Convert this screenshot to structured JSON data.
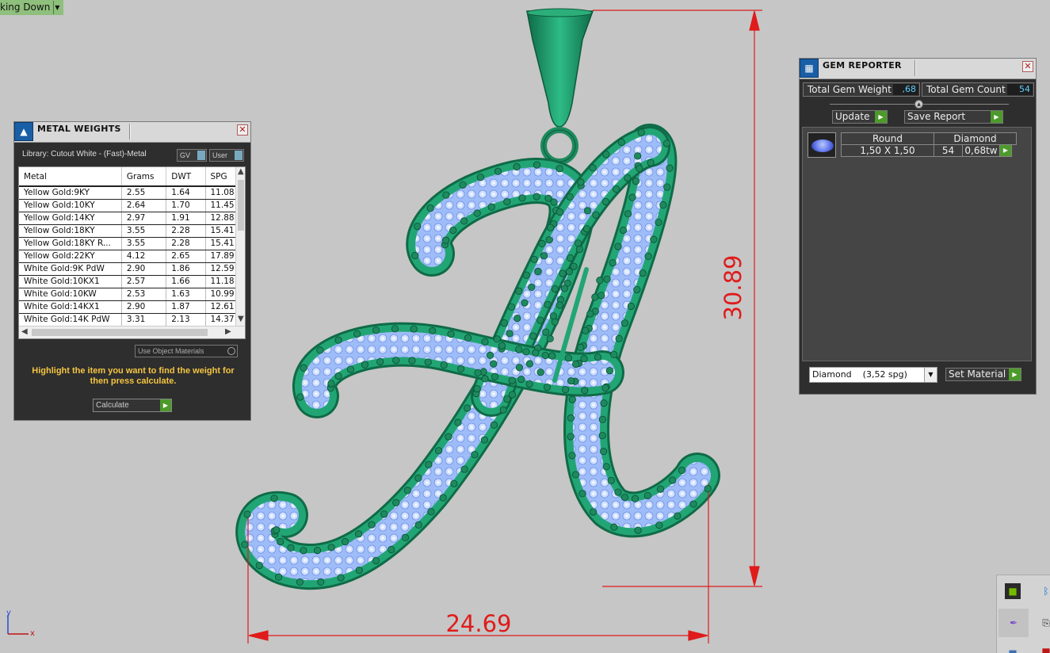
{
  "viewport": {
    "label": "king Down"
  },
  "dimensions": {
    "width": "24.69",
    "height": "30.89"
  },
  "axes": {
    "y": "y",
    "x": "x"
  },
  "metal_weights": {
    "title": "METAL WEIGHTS",
    "library": "Library: Cutout White - (Fast)-Metal",
    "btn_gv": "GV",
    "btn_user": "User",
    "columns": [
      "Metal",
      "Grams",
      "DWT",
      "SPG"
    ],
    "rows": [
      [
        "Yellow Gold:9KY",
        "2.55",
        "1.64",
        "11.08"
      ],
      [
        "Yellow Gold:10KY",
        "2.64",
        "1.70",
        "11.45"
      ],
      [
        "Yellow Gold:14KY",
        "2.97",
        "1.91",
        "12.88"
      ],
      [
        "Yellow Gold:18KY",
        "3.55",
        "2.28",
        "15.41"
      ],
      [
        "Yellow Gold:18KY R...",
        "3.55",
        "2.28",
        "15.41"
      ],
      [
        "Yellow Gold:22KY",
        "4.12",
        "2.65",
        "17.89"
      ],
      [
        "White Gold:9K PdW",
        "2.90",
        "1.86",
        "12.59"
      ],
      [
        "White Gold:10KX1",
        "2.57",
        "1.66",
        "11.18"
      ],
      [
        "White Gold:10KW",
        "2.53",
        "1.63",
        "10.99"
      ],
      [
        "White Gold:14KX1",
        "2.90",
        "1.87",
        "12.61"
      ],
      [
        "White Gold:14K PdW",
        "3.31",
        "2.13",
        "14.37"
      ]
    ],
    "use_object_materials": "Use Object Materials",
    "hint": "Highlight the item you want to find the weight for then press calculate.",
    "calculate": "Calculate"
  },
  "gem_reporter": {
    "title": "GEM REPORTER",
    "total_weight_label": "Total Gem Weight",
    "total_weight_value": ",68",
    "total_count_label": "Total Gem Count",
    "total_count_value": "54",
    "update": "Update",
    "save_report": "Save Report",
    "gem": {
      "shape": "Round",
      "material": "Diamond",
      "size": "1,50 X 1,50",
      "count": "54",
      "weight": "0,68tw"
    },
    "material_select": "Diamond    (3,52 spg)",
    "set_material": "Set Material"
  },
  "colors": {
    "metal_green": "#1f9e6e",
    "stone_blue": "#8fb4f4",
    "dimension_red": "#e01b1b",
    "viewport_bg": "#c6c6c6"
  }
}
